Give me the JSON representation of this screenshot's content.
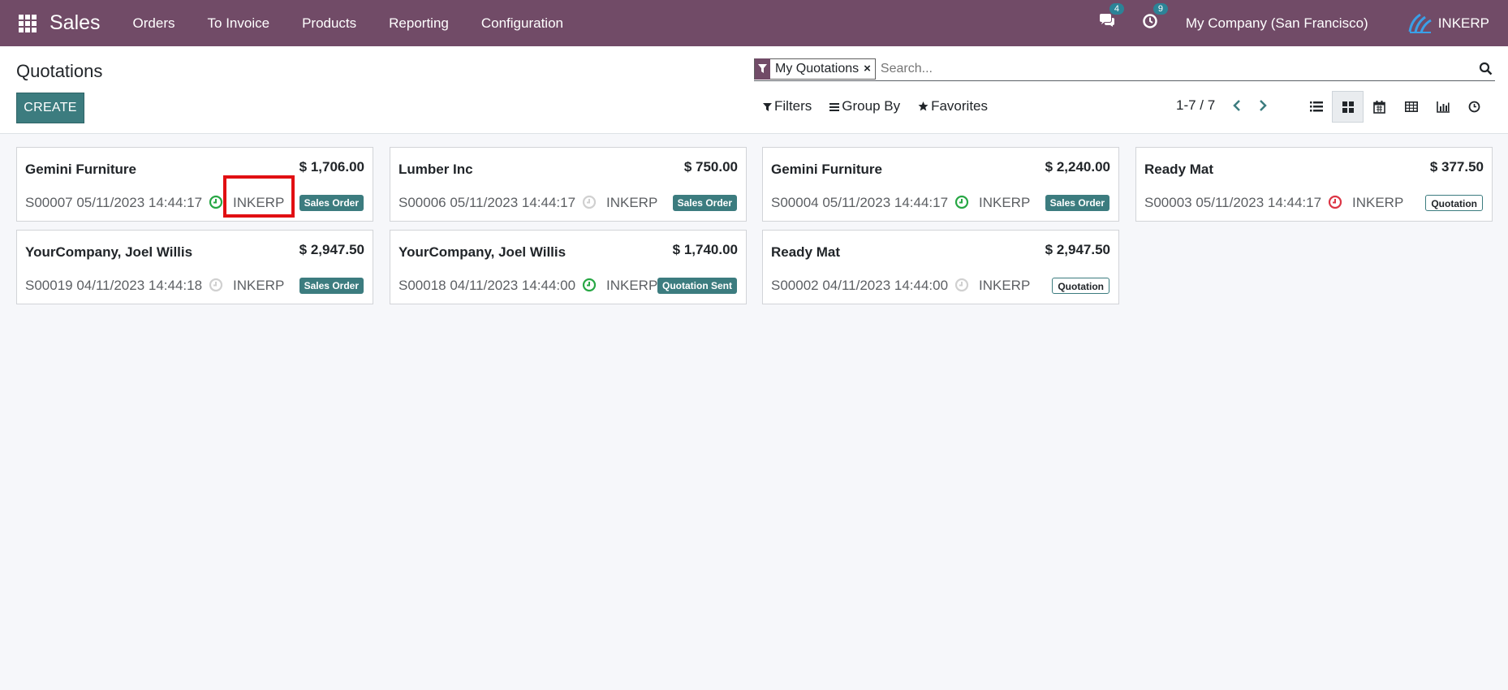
{
  "nav": {
    "app_name": "Sales",
    "menu": [
      "Orders",
      "To Invoice",
      "Products",
      "Reporting",
      "Configuration"
    ],
    "messages_count": "4",
    "activities_count": "9",
    "company": "My Company (San Francisco)",
    "user": "INKERP"
  },
  "control_panel": {
    "title": "Quotations",
    "create_label": "CREATE",
    "facet_label": "My Quotations",
    "search_placeholder": "Search...",
    "filters_label": "Filters",
    "group_by_label": "Group By",
    "favorites_label": "Favorites",
    "pager": "1-7 / 7",
    "views": [
      "list-view-icon",
      "kanban-view-icon",
      "calendar-view-icon",
      "pivot-view-icon",
      "graph-view-icon",
      "activity-view-icon"
    ]
  },
  "colors": {
    "brand": "#714b67",
    "primary": "#3c7c7f",
    "counter": "#2c8397",
    "activity_ok": "#28a745",
    "activity_overdue": "#dc3545",
    "activity_none": "#d0d0d0",
    "highlight": "#e10f12"
  },
  "cards": [
    {
      "customer": "Gemini Furniture",
      "amount": "$ 1,706.00",
      "ref": "S00007 05/11/2023 14:44:17",
      "owner": "INKERP",
      "status": "Sales Order",
      "activity": "ok"
    },
    {
      "customer": "Lumber Inc",
      "amount": "$ 750.00",
      "ref": "S00006 05/11/2023 14:44:17",
      "owner": "INKERP",
      "status": "Sales Order",
      "activity": "none"
    },
    {
      "customer": "Gemini Furniture",
      "amount": "$ 2,240.00",
      "ref": "S00004 05/11/2023 14:44:17",
      "owner": "INKERP",
      "status": "Sales Order",
      "activity": "ok"
    },
    {
      "customer": "Ready Mat",
      "amount": "$ 377.50",
      "ref": "S00003 05/11/2023 14:44:17",
      "owner": "INKERP",
      "status": "Quotation",
      "activity": "overdue"
    },
    {
      "customer": "YourCompany, Joel Willis",
      "amount": "$ 2,947.50",
      "ref": "S00019 04/11/2023 14:44:18",
      "owner": "INKERP",
      "status": "Sales Order",
      "activity": "none"
    },
    {
      "customer": "YourCompany, Joel Willis",
      "amount": "$ 1,740.00",
      "ref": "S00018 04/11/2023 14:44:00",
      "owner": "INKERP",
      "status": "Quotation Sent",
      "activity": "ok"
    },
    {
      "customer": "Ready Mat",
      "amount": "$ 2,947.50",
      "ref": "S00002 04/11/2023 14:44:00",
      "owner": "INKERP",
      "status": "Quotation",
      "activity": "none"
    }
  ]
}
